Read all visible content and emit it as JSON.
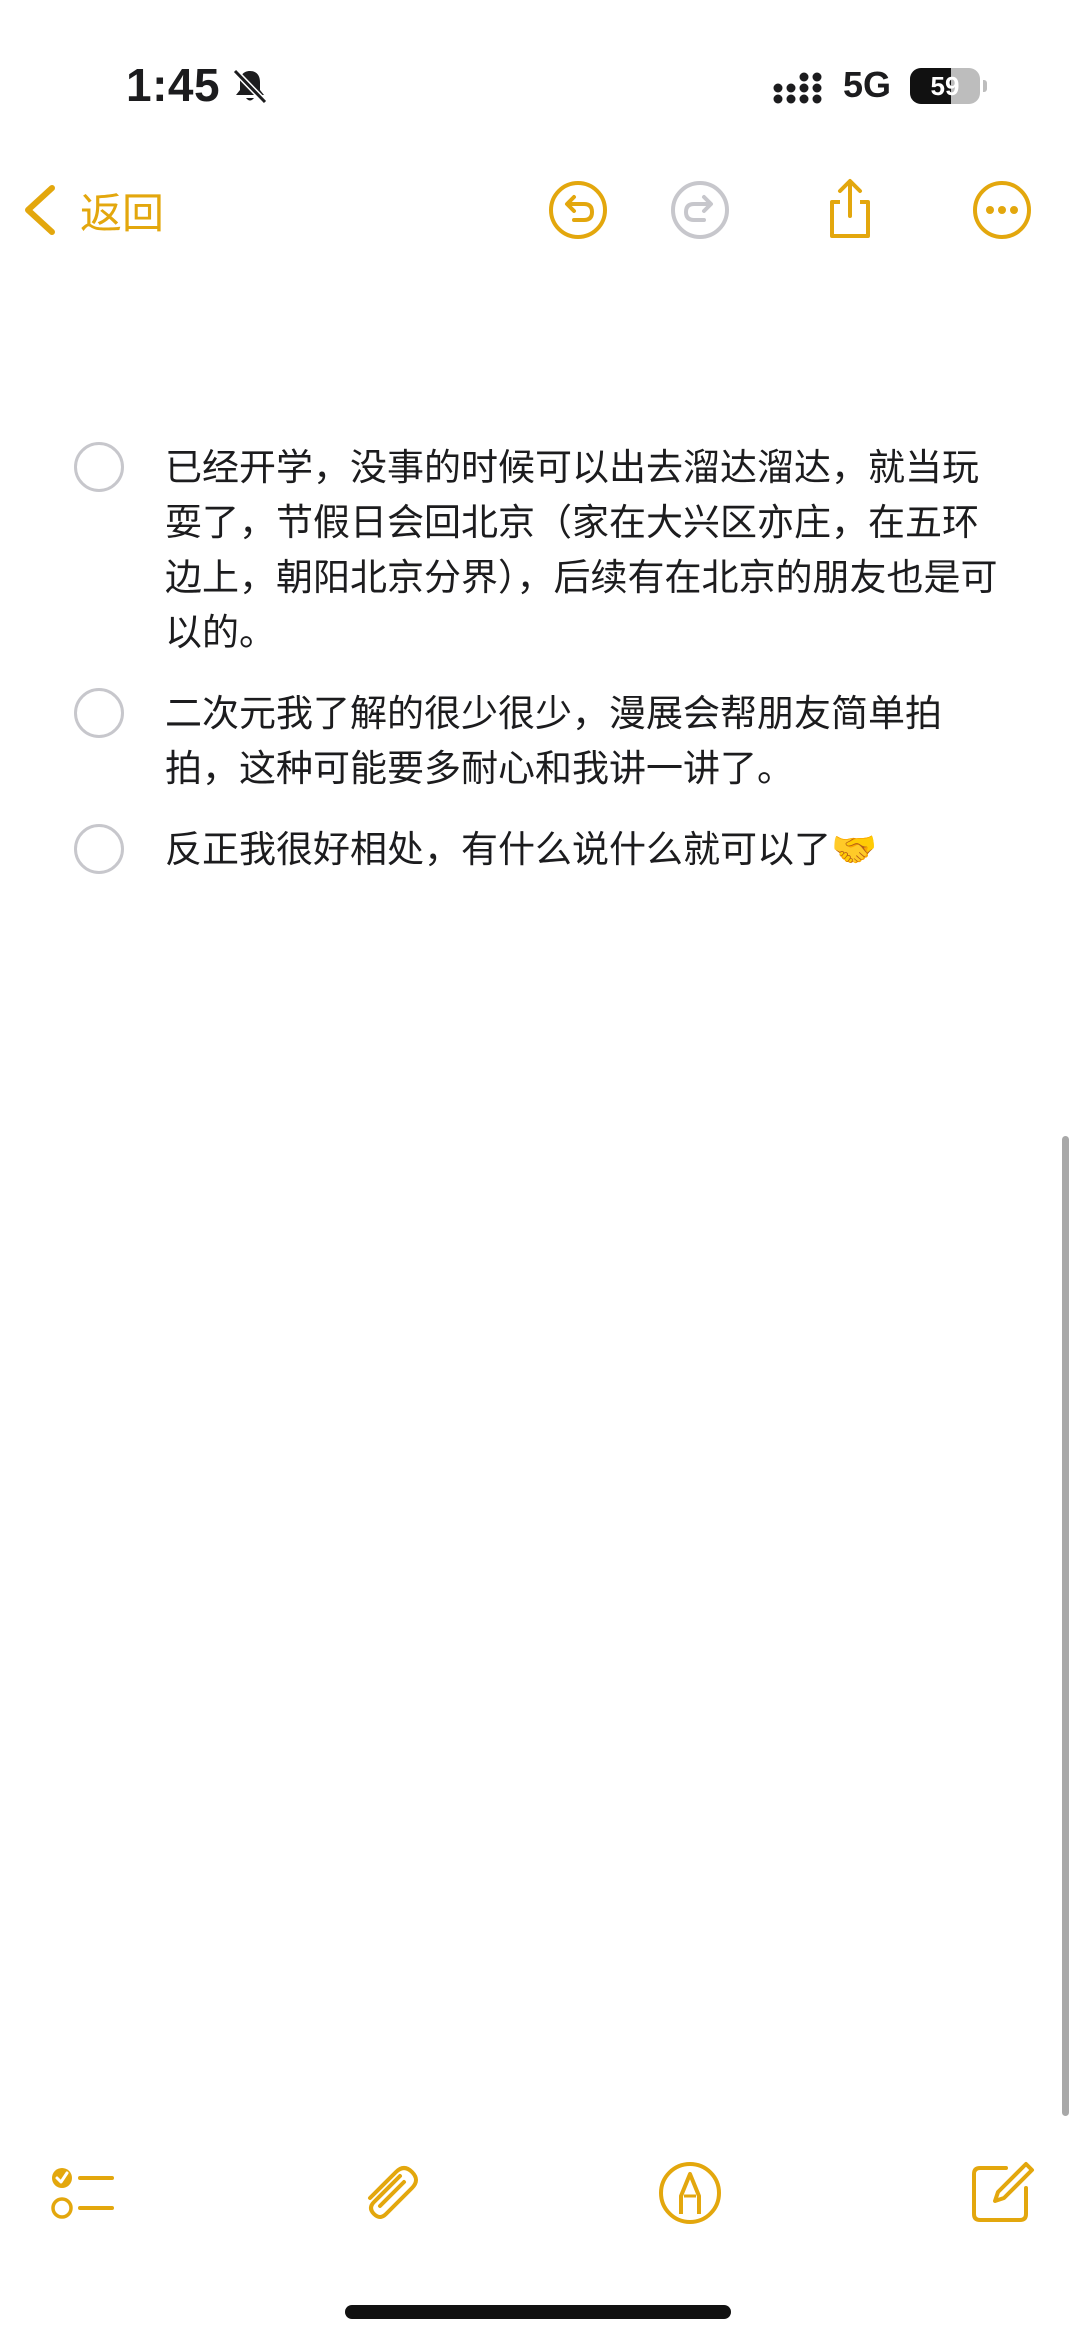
{
  "status_bar": {
    "time": "1:45",
    "network": "5G",
    "battery_level": "59"
  },
  "toolbar": {
    "back_label": "返回"
  },
  "checklist": [
    {
      "text": "已经开学，没事的时候可以出去溜达溜达，就当玩耍了，节假日会回北京（家在大兴区亦庄，在五环边上，朝阳北京分界），后续有在北京的朋友也是可以的。",
      "checked": false
    },
    {
      "text": "二次元我了解的很少很少，漫展会帮朋友简单拍拍，这种可能要多耐心和我讲一讲了。",
      "checked": false
    },
    {
      "text": "反正我很好相处，有什么说什么就可以了🤝",
      "checked": false
    }
  ],
  "icons": {
    "back": "chevron-left-icon",
    "undo": "undo-icon",
    "redo": "redo-icon",
    "share": "share-icon",
    "more": "more-icon",
    "checklist": "checklist-icon",
    "attach": "paperclip-icon",
    "markup": "markup-pen-icon",
    "compose": "compose-icon"
  },
  "colors": {
    "accent": "#e3a70d",
    "disabled": "#c7c7cc",
    "text": "#1c1c1e"
  }
}
